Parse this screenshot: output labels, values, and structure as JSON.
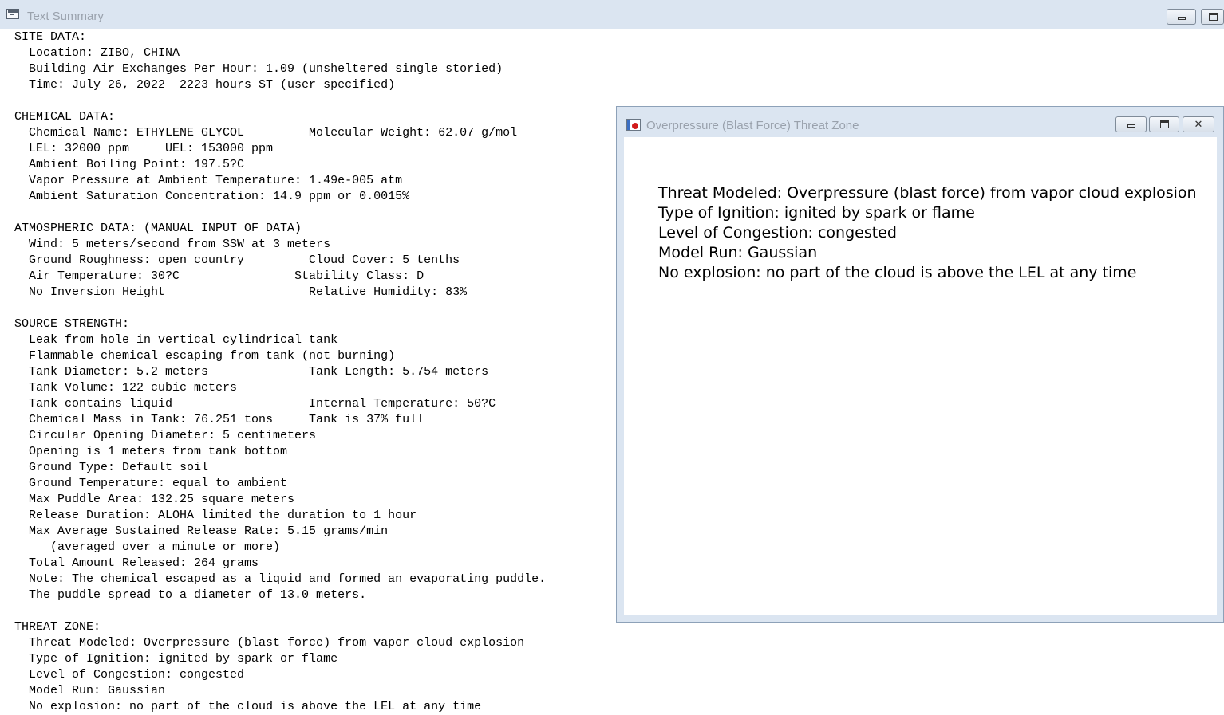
{
  "main_window": {
    "title": "Text Summary",
    "summary_lines": [
      "SITE DATA:",
      "  Location: ZIBO, CHINA",
      "  Building Air Exchanges Per Hour: 1.09 (unsheltered single storied)",
      "  Time: July 26, 2022  2223 hours ST (user specified)",
      "",
      "CHEMICAL DATA:",
      "  Chemical Name: ETHYLENE GLYCOL         Molecular Weight: 62.07 g/mol",
      "  LEL: 32000 ppm     UEL: 153000 ppm",
      "  Ambient Boiling Point: 197.5?C",
      "  Vapor Pressure at Ambient Temperature: 1.49e-005 atm",
      "  Ambient Saturation Concentration: 14.9 ppm or 0.0015%",
      "",
      "ATMOSPHERIC DATA: (MANUAL INPUT OF DATA)",
      "  Wind: 5 meters/second from SSW at 3 meters",
      "  Ground Roughness: open country         Cloud Cover: 5 tenths",
      "  Air Temperature: 30?C                Stability Class: D",
      "  No Inversion Height                    Relative Humidity: 83%",
      "",
      "SOURCE STRENGTH:",
      "  Leak from hole in vertical cylindrical tank",
      "  Flammable chemical escaping from tank (not burning)",
      "  Tank Diameter: 5.2 meters              Tank Length: 5.754 meters",
      "  Tank Volume: 122 cubic meters",
      "  Tank contains liquid                   Internal Temperature: 50?C",
      "  Chemical Mass in Tank: 76.251 tons     Tank is 37% full",
      "  Circular Opening Diameter: 5 centimeters",
      "  Opening is 1 meters from tank bottom",
      "  Ground Type: Default soil",
      "  Ground Temperature: equal to ambient",
      "  Max Puddle Area: 132.25 square meters",
      "  Release Duration: ALOHA limited the duration to 1 hour",
      "  Max Average Sustained Release Rate: 5.15 grams/min",
      "     (averaged over a minute or more)",
      "  Total Amount Released: 264 grams",
      "  Note: The chemical escaped as a liquid and formed an evaporating puddle.",
      "  The puddle spread to a diameter of 13.0 meters.",
      "",
      "THREAT ZONE:",
      "  Threat Modeled: Overpressure (blast force) from vapor cloud explosion",
      "  Type of Ignition: ignited by spark or flame",
      "  Level of Congestion: congested",
      "  Model Run: Gaussian",
      "  No explosion: no part of the cloud is above the LEL at any time"
    ]
  },
  "popup_window": {
    "title": "Overpressure (Blast Force) Threat Zone",
    "lines": [
      "Threat Modeled: Overpressure (blast force) from vapor cloud explosion",
      "Type of Ignition: ignited by spark or flame",
      "Level of Congestion: congested",
      "Model Run: Gaussian",
      "No explosion: no part of the cloud is above the LEL at any time"
    ]
  },
  "icons": {
    "main_app": "window-icon",
    "popup_app": "aloha-app-icon",
    "minimize": "minimize-icon",
    "maximize": "maximize-icon",
    "close": "close-icon",
    "close_glyph": "✕"
  }
}
